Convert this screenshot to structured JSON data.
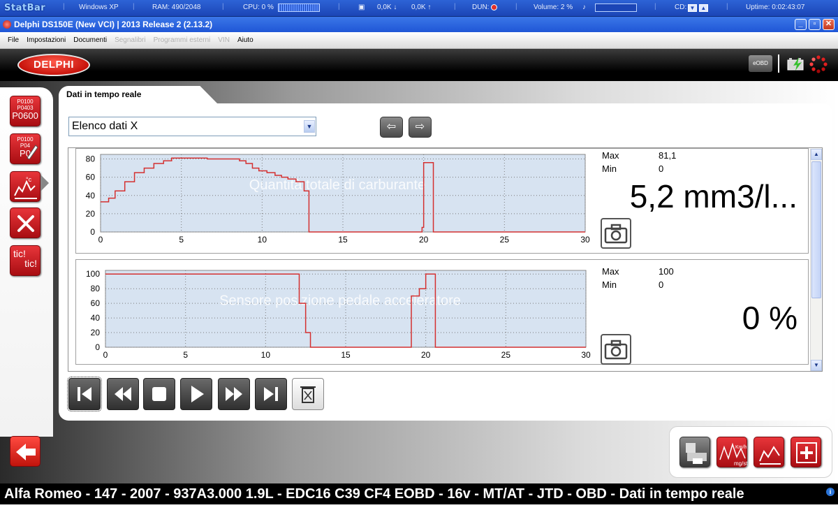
{
  "statbar": {
    "logo": "StatBar",
    "os": "Windows XP",
    "ram": "RAM: 490/2048",
    "cpu": "CPU: 0 %",
    "net_down": "0,0K",
    "net_up": "0,0K",
    "dun": "DUN:",
    "volume": "Volume: 2 %",
    "cd": "CD:",
    "uptime": "Uptime: 0:02:43:07"
  },
  "window": {
    "title": "Delphi DS150E (New VCI) | 2013 Release 2 (2.13.2)"
  },
  "menu": {
    "file": "File",
    "impostazioni": "Impostazioni",
    "documenti": "Documenti",
    "segnalibri": "Segnalibri",
    "programmi_esterni": "Programmi esterni",
    "vin": "VIN",
    "aiuto": "Aiuto"
  },
  "header": {
    "logo": "DELPHI",
    "eobd": "eOBD"
  },
  "sidebar": {
    "dtc_codes": [
      "P0100",
      "P0403",
      "P0600"
    ],
    "dtc_erase_codes": [
      "P0100",
      "P04",
      "P0"
    ],
    "ticks": "tic!",
    "ticks2": "tic!"
  },
  "tab": {
    "label": "Dati in tempo reale"
  },
  "combo": {
    "selected": "Elenco dati X"
  },
  "graph1": {
    "title": "Quantità totale di carburante",
    "max_label": "Max",
    "min_label": "Min",
    "max_value": "81,1",
    "min_value": "0",
    "current": "5,2 mm3/l..."
  },
  "graph2": {
    "title": "Sensore posizione pedale acceleratore",
    "max_label": "Max",
    "min_label": "Min",
    "max_value": "100",
    "min_value": "0",
    "current": "0 %"
  },
  "footer": {
    "vehicle": "Alfa Romeo - 147 - 2007 - 937A3.000 1.9L - EDC16 C39 CF4 EOBD - 16v - MT/AT - JTD - OBD - Dati in tempo reale"
  },
  "colors": {
    "accent_red": "#c8140c",
    "plot_bg": "#d7e3f1",
    "trace": "#d43030"
  },
  "chart_data": [
    {
      "type": "line",
      "title": "Quantità totale di carburante",
      "xlim": [
        0,
        30
      ],
      "ylim": [
        0,
        85
      ],
      "xticks": [
        0,
        5,
        10,
        15,
        20,
        25,
        30
      ],
      "yticks": [
        0,
        20,
        40,
        60,
        80
      ],
      "grid": true,
      "series": [
        {
          "x": [
            0,
            0.5,
            0.5,
            0.9,
            0.9,
            1.5,
            1.5,
            2.1,
            2.1,
            2.7,
            2.7,
            3.3,
            3.3,
            3.9,
            3.9,
            4.4,
            4.4,
            6.6,
            6.6,
            8.6,
            8.6,
            9.0,
            9.0,
            9.4,
            9.4,
            9.8,
            9.8,
            10.3,
            10.3,
            10.8,
            10.8,
            11.2,
            11.2,
            11.6,
            11.6,
            12.1,
            12.1,
            12.6,
            12.6,
            12.9,
            12.9,
            19.9,
            19.9,
            20.0,
            20.0,
            20.6,
            20.6,
            30
          ],
          "y": [
            33,
            33,
            37,
            37,
            45,
            45,
            55,
            55,
            65,
            65,
            70,
            70,
            75,
            75,
            78,
            78,
            81,
            81,
            80,
            80,
            78,
            78,
            75,
            75,
            70,
            70,
            67,
            67,
            65,
            65,
            62,
            62,
            60,
            60,
            58,
            58,
            55,
            55,
            45,
            45,
            0,
            0,
            5,
            5,
            76,
            76,
            0,
            0
          ]
        }
      ]
    },
    {
      "type": "line",
      "title": "Sensore posizione pedale acceleratore",
      "xlim": [
        0,
        30
      ],
      "ylim": [
        0,
        105
      ],
      "xticks": [
        0,
        5,
        10,
        15,
        20,
        25,
        30
      ],
      "yticks": [
        0,
        20,
        40,
        60,
        80,
        100
      ],
      "grid": true,
      "series": [
        {
          "x": [
            0,
            12.1,
            12.1,
            12.5,
            12.5,
            12.8,
            12.8,
            19.1,
            19.1,
            19.6,
            19.6,
            20.0,
            20.0,
            20.6,
            20.6,
            30
          ],
          "y": [
            100,
            100,
            60,
            60,
            20,
            20,
            0,
            0,
            70,
            70,
            80,
            80,
            100,
            100,
            0,
            0
          ]
        }
      ]
    }
  ]
}
